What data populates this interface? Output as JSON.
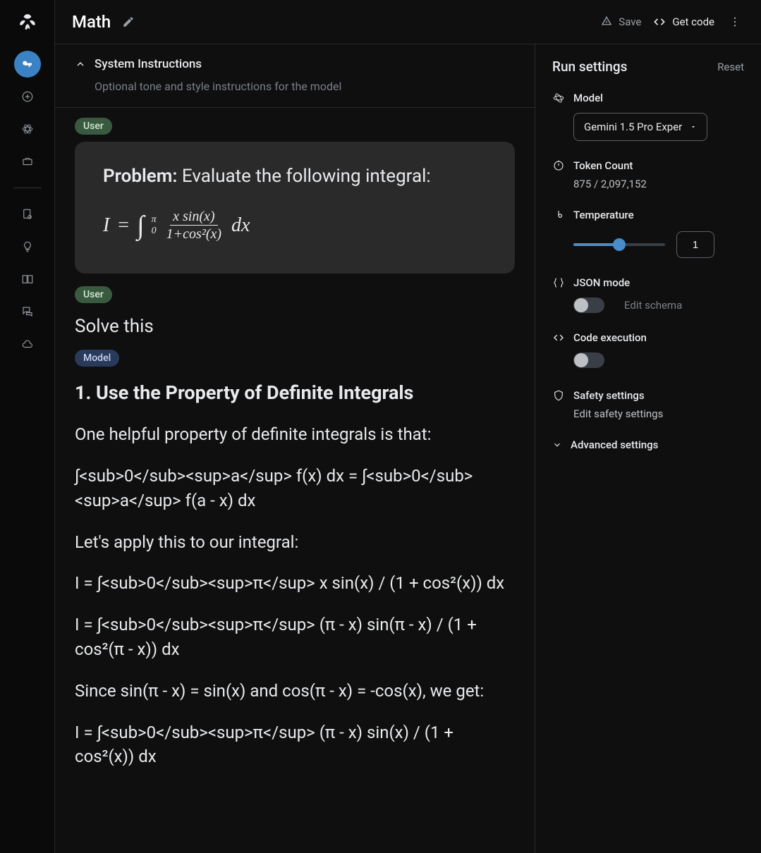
{
  "header": {
    "title": "Math",
    "save": "Save",
    "getcode": "Get code"
  },
  "sysinst": {
    "title": "System Instructions",
    "placeholder": "Optional tone and style instructions for the model"
  },
  "badges": {
    "user": "User",
    "model": "Model"
  },
  "msg": {
    "problem_label": "Problem:",
    "problem_text": " Evaluate the following integral:",
    "user_text": "Solve this",
    "model_h": "1. Use the Property of Definite Integrals",
    "model_p1": "One helpful property of definite integrals is that:",
    "model_p2": "∫<sub>0</sub><sup>a</sup> f(x) dx = ∫<sub>0</sub><sup>a</sup> f(a - x) dx",
    "model_p3": "Let's apply this to our integral:",
    "model_p4": "I = ∫<sub>0</sub><sup>π</sup> x sin(x) / (1 + cos²(x)) dx",
    "model_p5": "I = ∫<sub>0</sub><sup>π</sup> (π - x) sin(π - x) / (1 + cos²(π - x)) dx",
    "model_p6": "Since sin(π - x) = sin(x) and cos(π - x) = -cos(x), we get:",
    "model_p7": "I = ∫<sub>0</sub><sup>π</sup> (π - x) sin(x) / (1 + cos²(x)) dx"
  },
  "settings": {
    "title": "Run settings",
    "reset": "Reset",
    "model_label": "Model",
    "model_value": "Gemini 1.5 Pro Exper",
    "token_label": "Token Count",
    "token_value": "875 / 2,097,152",
    "temp_label": "Temperature",
    "temp_value": "1",
    "json_label": "JSON mode",
    "edit_schema": "Edit schema",
    "code_label": "Code execution",
    "safety_label": "Safety settings",
    "edit_safety": "Edit safety settings",
    "advanced": "Advanced settings"
  }
}
